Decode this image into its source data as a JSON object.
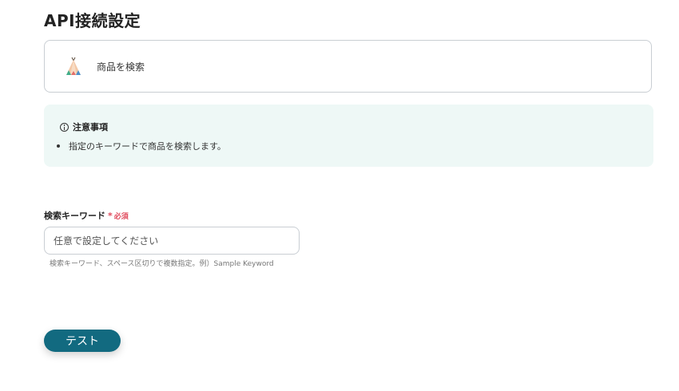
{
  "page": {
    "title": "API接続設定"
  },
  "action": {
    "label": "商品を検索",
    "icon": "teepee-icon"
  },
  "notice": {
    "title": "注意事項",
    "icon": "info-icon",
    "items": [
      "指定のキーワードで商品を検索します。"
    ]
  },
  "form": {
    "keyword": {
      "label": "検索キーワード",
      "required_mark": "*",
      "required_text": "必須",
      "placeholder": "任意で設定してください",
      "value": "",
      "help": "検索キーワード、スペース区切りで複数指定。例）Sample Keyword"
    }
  },
  "buttons": {
    "test_label": "テスト"
  },
  "colors": {
    "primary": "#126a80",
    "notice_bg": "#eef8f6",
    "required": "#e0495b",
    "border": "#c9ced3"
  }
}
